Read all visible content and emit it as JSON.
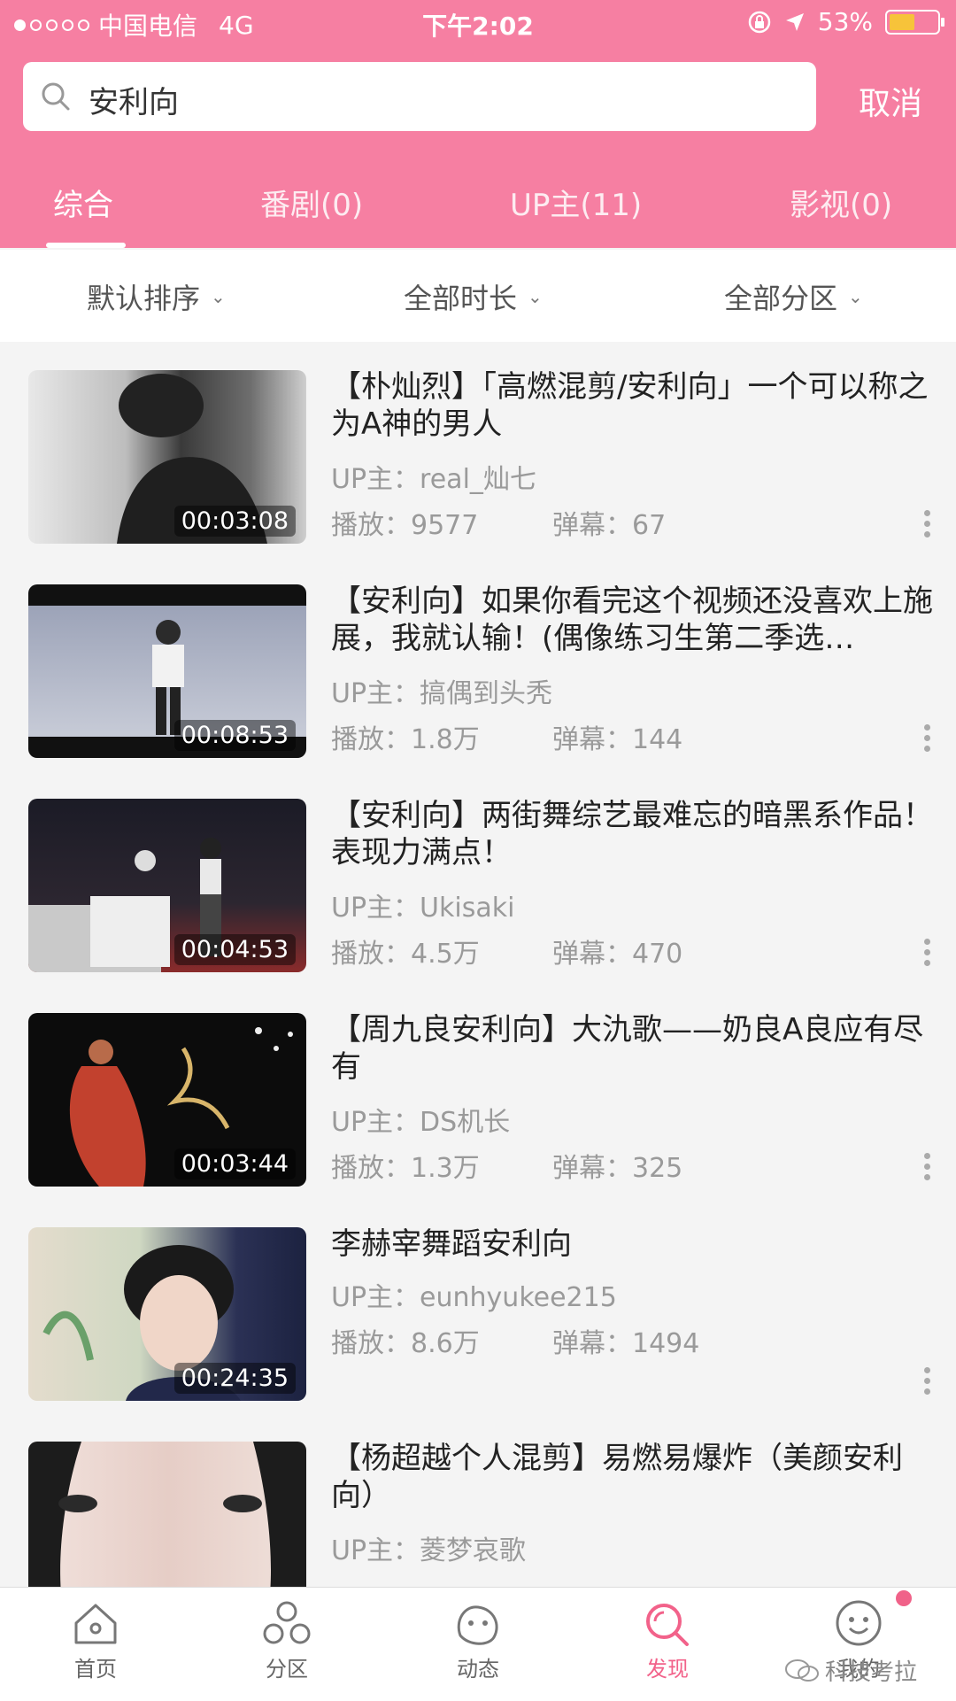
{
  "status_bar": {
    "carrier": "中国电信",
    "network": "4G",
    "time": "下午2:02",
    "battery": "53%"
  },
  "search": {
    "query": "安利向",
    "cancel_label": "取消"
  },
  "tabs": [
    {
      "label": "综合"
    },
    {
      "label": "番剧(0)"
    },
    {
      "label": "UP主(11)"
    },
    {
      "label": "影视(0)"
    }
  ],
  "filters": [
    {
      "label": "默认排序"
    },
    {
      "label": "全部时长"
    },
    {
      "label": "全部分区"
    }
  ],
  "results": [
    {
      "title": "【朴灿烈】「高燃混剪/安利向」一个可以称之为A神的男人",
      "up": "UP主：real_灿七",
      "play": "播放：9577",
      "danmu": "弹幕：67",
      "duration": "00:03:08"
    },
    {
      "title": "【安利向】如果你看完这个视频还没喜欢上施展，我就认输！(偶像练习生第二季选…",
      "up": "UP主：搞偶到头秃",
      "play": "播放：1.8万",
      "danmu": "弹幕：144",
      "duration": "00:08:53"
    },
    {
      "title": "【安利向】两街舞综艺最难忘的暗黑系作品！表现力满点！",
      "up": "UP主：Ukisaki",
      "play": "播放：4.5万",
      "danmu": "弹幕：470",
      "duration": "00:04:53"
    },
    {
      "title": "【周九良安利向】大氿歌——奶良A良应有尽有",
      "up": "UP主：DS机长",
      "play": "播放：1.3万",
      "danmu": "弹幕：325",
      "duration": "00:03:44"
    },
    {
      "title": "李赫宰舞蹈安利向",
      "up": "UP主：eunhyukee215",
      "play": "播放：8.6万",
      "danmu": "弹幕：1494",
      "duration": "00:24:35"
    },
    {
      "title": "【杨超越个人混剪】易燃易爆炸（美颜安利向）",
      "up": "UP主：菱梦哀歌",
      "play": "",
      "danmu": "",
      "duration": ""
    }
  ],
  "bottom_nav": [
    {
      "label": "首页",
      "icon": "home-icon"
    },
    {
      "label": "分区",
      "icon": "category-icon"
    },
    {
      "label": "动态",
      "icon": "feed-icon"
    },
    {
      "label": "发现",
      "icon": "search-icon"
    },
    {
      "label": "我的",
      "icon": "profile-icon"
    }
  ],
  "watermark": "科技考拉",
  "colors": {
    "accent": "#f67fa2",
    "nav_active": "#f2628a"
  }
}
